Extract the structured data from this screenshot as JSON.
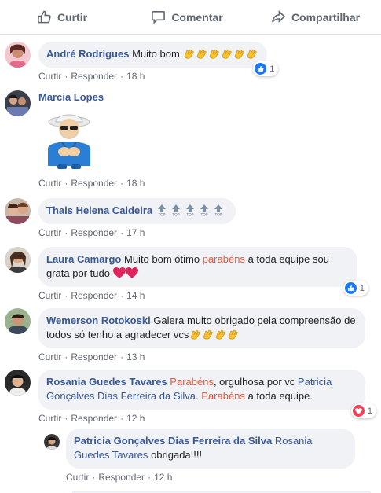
{
  "actions": {
    "like": "Curtir",
    "comment": "Comentar",
    "share": "Compartilhar"
  },
  "labels": {
    "like": "Curtir",
    "reply": "Responder",
    "sep": "·"
  },
  "colors": {
    "author": "#385898",
    "highlight": "#e9573f",
    "bubble": "#f0f2f5",
    "like": "#1877f2",
    "love": "#f33e58"
  },
  "comments": [
    {
      "author": "André Rodrigues",
      "text": "Muito bom",
      "emojis": "clapping-hands x6",
      "time": "18 h",
      "reaction": {
        "type": "like-icon",
        "count": "1"
      }
    },
    {
      "author": "Marcia Lopes",
      "sticker": "old-man-clapping-sticker",
      "time": "18 h"
    },
    {
      "author": "Thais Helena Caldeira",
      "emojis": "top-arrow x5",
      "time": "17 h"
    },
    {
      "author": "Laura Camargo",
      "text_a": "Muito bom ótimo",
      "highlight": "parabéns",
      "text_b": "a toda equipe sou grata por tudo",
      "emojis": "red-heart x2",
      "time": "14 h",
      "reaction": {
        "type": "like-icon",
        "count": "1"
      }
    },
    {
      "author": "Wemerson Rotokoski",
      "text": "Galera muito obrigado pela compreensão de todos só tenho a agradecer vcs",
      "emojis": "clapping-hands x4",
      "time": "13 h"
    },
    {
      "author": "Rosania Guedes Tavares",
      "highlight": "Parabéns",
      "text_a": ", orgulhosa por vc",
      "mention": "Patricia Gonçalves Dias Ferreira da Silva",
      "highlight2": "Parabéns",
      "text_b": "a toda equipe.",
      "time": "12 h",
      "reaction": {
        "type": "love-icon",
        "count": "1"
      }
    },
    {
      "author": "Patricia Gonçalves Dias Ferreira da Silva",
      "mention": "Rosania Guedes Tavares",
      "text": "obrigada!!!!",
      "time": "12 h"
    }
  ]
}
